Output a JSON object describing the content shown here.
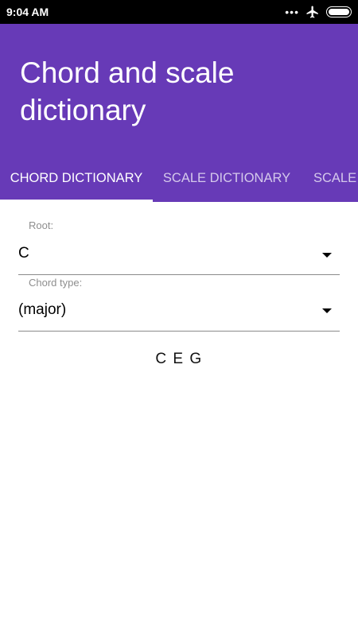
{
  "status_bar": {
    "time": "9:04 AM",
    "icons": [
      "more-dots-icon",
      "airplane-icon",
      "battery-icon"
    ]
  },
  "app_bar": {
    "title": "Chord and scale dictionary",
    "color": "#673ab7"
  },
  "tabs": [
    {
      "label": "CHORD DICTIONARY",
      "active": true
    },
    {
      "label": "SCALE DICTIONARY",
      "active": false
    },
    {
      "label": "SCALE",
      "active": false
    }
  ],
  "form": {
    "root": {
      "label": "Root:",
      "value": "C"
    },
    "chord_type": {
      "label": "Chord type:",
      "value": "(major)"
    }
  },
  "result": {
    "notes": "C E G"
  }
}
